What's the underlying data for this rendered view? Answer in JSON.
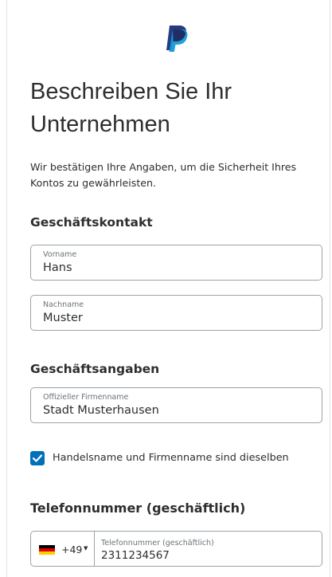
{
  "brand": {
    "logo_icon": "paypal-logo-icon",
    "colors": {
      "dark": "#253b80",
      "light": "#179bd7",
      "accent": "#0070ba"
    }
  },
  "page": {
    "title": "Beschreiben Sie Ihr Unternehmen",
    "description": "Wir bestätigen Ihre Angaben, um die Sicherheit Ihres Kontos zu gewährleisten."
  },
  "sections": {
    "contact": "Geschäftskontakt",
    "business": "Geschäftsangaben",
    "phone": "Telefonnummer (geschäftlich)"
  },
  "fields": {
    "first_name": {
      "label": "Vorname",
      "value": "Hans"
    },
    "last_name": {
      "label": "Nachname",
      "value": "Muster"
    },
    "company": {
      "label": "Offizieller Firmenname",
      "value": "Stadt Musterhausen"
    }
  },
  "checkbox": {
    "label": "Handelsname und Firmenname sind dieselben",
    "checked": true,
    "icon": "checkmark-icon"
  },
  "phone": {
    "country_code": "+49",
    "country_flag": "germany-flag-icon",
    "label": "Telefonnummer (geschäftlich)",
    "value": "2311234567"
  }
}
